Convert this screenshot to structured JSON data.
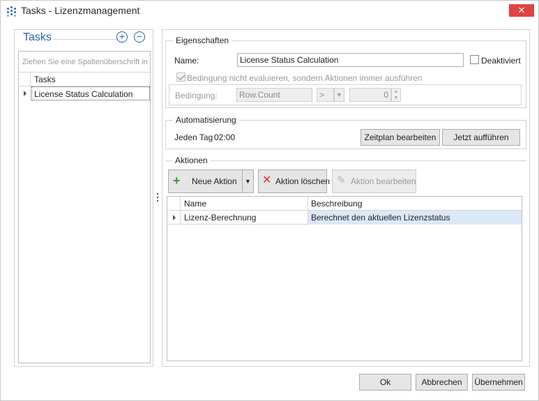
{
  "window": {
    "title": "Tasks - Lizenzmanagement",
    "close_glyph": "✕"
  },
  "left_panel": {
    "title": "Tasks",
    "add_glyph": "+",
    "remove_glyph": "−",
    "group_hint": "Ziehen Sie eine Spaltenüberschrift in d",
    "column_header": "Tasks",
    "rows": [
      "License Status Calculation"
    ]
  },
  "properties": {
    "title": "Eigenschaften",
    "name_label": "Name:",
    "name_value": "License Status Calculation",
    "deactivated_label": "Deaktiviert",
    "skip_condition_label": "Bedingung nicht evaluieren, sondern Aktionen immer ausführen",
    "condition_label": "Bedingung:",
    "condition_field": "Row.Count",
    "condition_operator": ">",
    "condition_value": "0"
  },
  "automation": {
    "title": "Automatisierung",
    "schedule_day": "Jeden Tag",
    "schedule_time": "02:00",
    "edit_schedule_button": "Zeitplan bearbeiten",
    "run_now_button": "Jetzt aufführen"
  },
  "actions": {
    "title": "Aktionen",
    "new_action_button": "Neue Aktion",
    "delete_action_button": "Aktion löschen",
    "edit_action_button": "Aktion bearbeiten",
    "columns": [
      "Name",
      "Beschreibung"
    ],
    "rows": [
      {
        "name": "Lizenz-Berechnung",
        "description": "Berechnet den aktuellen Lizenzstatus"
      }
    ]
  },
  "footer": {
    "ok_button": "Ok",
    "cancel_button": "Abbrechen",
    "apply_button": "Übernehmen"
  },
  "colors": {
    "accent": "#2a5fa8",
    "close": "#e04343",
    "selection": "#dbe8f7",
    "add_icon": "#3a9a3a",
    "delete_icon": "#d23a3a"
  }
}
